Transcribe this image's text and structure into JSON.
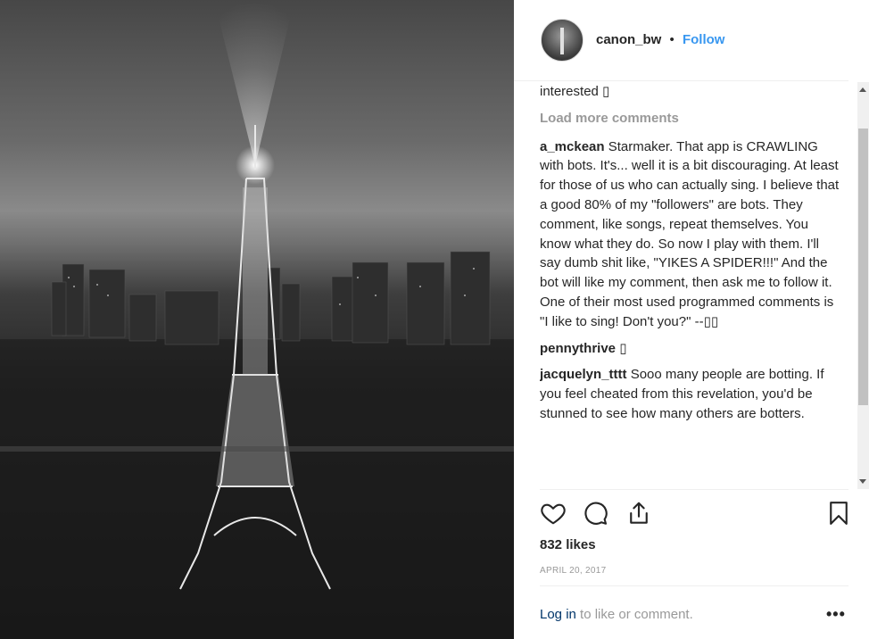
{
  "post": {
    "username": "canon_bw",
    "separator": "•",
    "follow_label": "Follow",
    "comments": [
      {
        "text": "interested ▯"
      },
      {
        "load_more": "Load more comments"
      },
      {
        "username": "a_mckean",
        "text": "Starmaker. That app is CRAWLING with bots. It's... well it is a bit discouraging. At least for those of us who can actually sing. I believe that a good 80% of my \"followers\" are bots. They comment, like songs, repeat themselves. You know what they do. So now I play with them. I'll say dumb shit like, \"YIKES A SPIDER!!!\" And the bot will like my comment, then ask me to follow it. One of their most used programmed comments is \"I like to sing! Don't you?\" --▯▯"
      },
      {
        "username": "pennythrive",
        "text": "▯"
      },
      {
        "username": "jacquelyn_tttt",
        "text": "Sooo many people are botting. If you feel cheated from this revelation, you'd be stunned to see how many others are botters."
      }
    ],
    "likes": "832 likes",
    "date": "APRIL 20, 2017",
    "login_link": "Log in",
    "login_rest": " to like or comment.",
    "more_label": "•••"
  },
  "icons": {
    "like": "heart-outline-icon",
    "comment": "speech-bubble-icon",
    "share": "share-upload-icon",
    "save": "bookmark-icon",
    "more": "more-options-icon"
  }
}
